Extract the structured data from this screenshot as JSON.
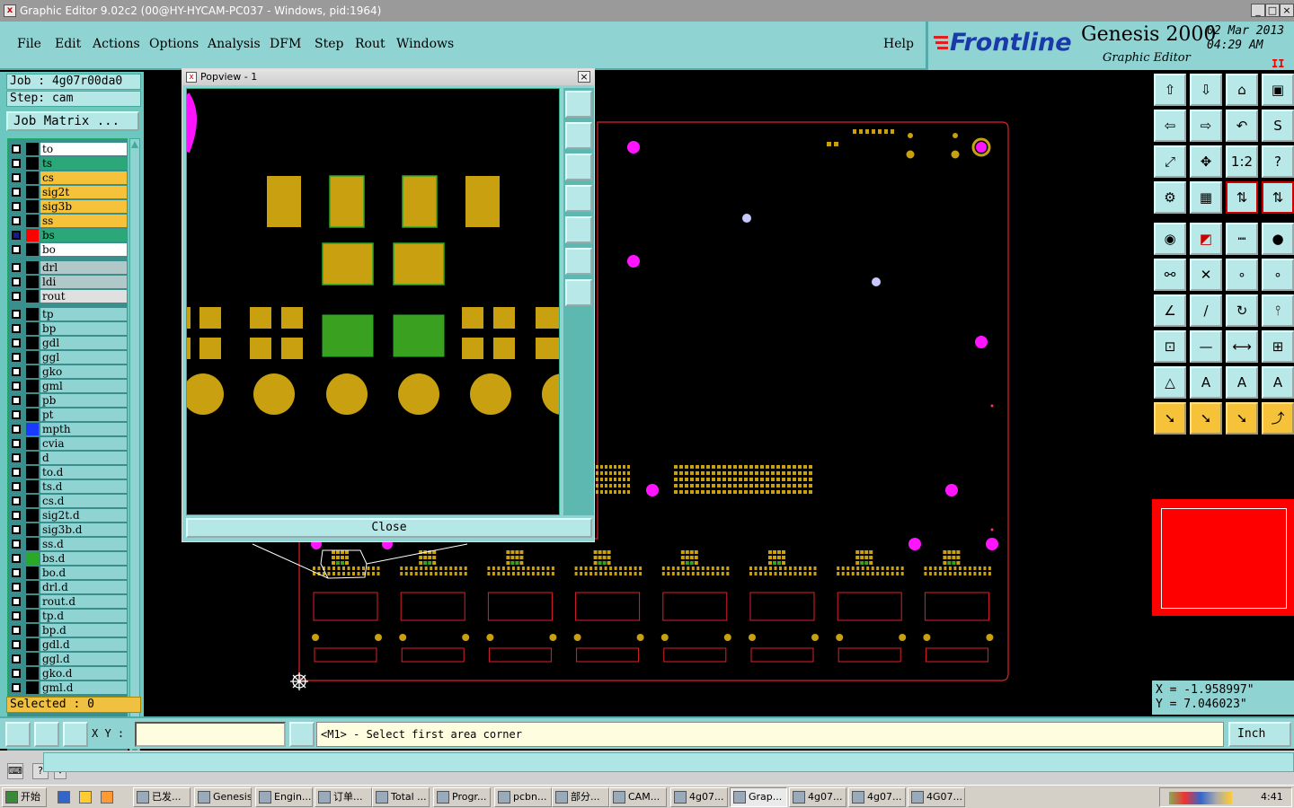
{
  "window": {
    "title": "Graphic Editor 9.02c2 (00@HY-HYCAM-PC037 - Windows, pid:1964)",
    "minimize": "_",
    "maximize": "□",
    "close": "×"
  },
  "menu": {
    "items": [
      "File",
      "Edit",
      "Actions",
      "Options",
      "Analysis",
      "DFM",
      "Step",
      "Rout",
      "Windows"
    ],
    "help": "Help"
  },
  "brand": {
    "logo": "Frontline",
    "product": "Genesis 2000",
    "subtitle": "Graphic Editor",
    "date": "02 Mar 2013",
    "time": "04:29 AM",
    "pause": "II",
    "logo_color": "#1a3aa8"
  },
  "left": {
    "job": "Job : 4g07r00da0",
    "step": "Step: cam",
    "job_matrix": "Job Matrix ...",
    "selected": "Selected : 0",
    "layers": [
      {
        "name": "to",
        "color": "#ffffff",
        "swatch": "#000000"
      },
      {
        "name": "ts",
        "color": "#2aa878",
        "swatch": "#000000"
      },
      {
        "name": "cs",
        "color": "#f6c23a",
        "swatch": "#000000"
      },
      {
        "name": "sig2t",
        "color": "#f6c23a",
        "swatch": "#000000"
      },
      {
        "name": "sig3b",
        "color": "#f6c23a",
        "swatch": "#000000"
      },
      {
        "name": "ss",
        "color": "#f6c23a",
        "swatch": "#000000"
      },
      {
        "name": "bs",
        "color": "#2aa878",
        "swatch": "#ff0000",
        "active": true
      },
      {
        "name": "bo",
        "color": "#ffffff",
        "swatch": "#000000"
      },
      {
        "name": "drl",
        "color": "#b0c8c8",
        "swatch": "#000000",
        "gap": true
      },
      {
        "name": "ldi",
        "color": "#b0c8c8",
        "swatch": "#000000"
      },
      {
        "name": "rout",
        "color": "#e0e0e0",
        "swatch": "#000000"
      },
      {
        "name": "tp",
        "color": "#8fd3d3",
        "swatch": "#000000",
        "gap": true
      },
      {
        "name": "bp",
        "color": "#8fd3d3",
        "swatch": "#000000"
      },
      {
        "name": "gdl",
        "color": "#8fd3d3",
        "swatch": "#000000"
      },
      {
        "name": "ggl",
        "color": "#8fd3d3",
        "swatch": "#000000"
      },
      {
        "name": "gko",
        "color": "#8fd3d3",
        "swatch": "#000000"
      },
      {
        "name": "gml",
        "color": "#8fd3d3",
        "swatch": "#000000"
      },
      {
        "name": "pb",
        "color": "#8fd3d3",
        "swatch": "#000000"
      },
      {
        "name": "pt",
        "color": "#8fd3d3",
        "swatch": "#000000"
      },
      {
        "name": "mpth",
        "color": "#8fd3d3",
        "swatch": "#1a3aff"
      },
      {
        "name": "cvia",
        "color": "#8fd3d3",
        "swatch": "#000000"
      },
      {
        "name": "d",
        "color": "#8fd3d3",
        "swatch": "#000000"
      },
      {
        "name": "to.d",
        "color": "#8fd3d3",
        "swatch": "#000000"
      },
      {
        "name": "ts.d",
        "color": "#8fd3d3",
        "swatch": "#000000"
      },
      {
        "name": "cs.d",
        "color": "#8fd3d3",
        "swatch": "#000000"
      },
      {
        "name": "sig2t.d",
        "color": "#8fd3d3",
        "swatch": "#000000"
      },
      {
        "name": "sig3b.d",
        "color": "#8fd3d3",
        "swatch": "#000000"
      },
      {
        "name": "ss.d",
        "color": "#8fd3d3",
        "swatch": "#000000"
      },
      {
        "name": "bs.d",
        "color": "#8fd3d3",
        "swatch": "#2aa828"
      },
      {
        "name": "bo.d",
        "color": "#8fd3d3",
        "swatch": "#000000"
      },
      {
        "name": "drl.d",
        "color": "#8fd3d3",
        "swatch": "#000000"
      },
      {
        "name": "rout.d",
        "color": "#8fd3d3",
        "swatch": "#000000"
      },
      {
        "name": "tp.d",
        "color": "#8fd3d3",
        "swatch": "#000000"
      },
      {
        "name": "bp.d",
        "color": "#8fd3d3",
        "swatch": "#000000"
      },
      {
        "name": "gdl.d",
        "color": "#8fd3d3",
        "swatch": "#000000"
      },
      {
        "name": "ggl.d",
        "color": "#8fd3d3",
        "swatch": "#000000"
      },
      {
        "name": "gko.d",
        "color": "#8fd3d3",
        "swatch": "#000000"
      },
      {
        "name": "gml.d",
        "color": "#8fd3d3",
        "swatch": "#000000"
      }
    ]
  },
  "popview": {
    "title": "Popview - 1",
    "close_label": "Close"
  },
  "coords": {
    "x": "X = -1.958997\"",
    "y": "Y = 7.046023\""
  },
  "command": {
    "xy_label": "X Y :",
    "xy_value": "",
    "prompt": "<M1> - Select first area corner",
    "units": "Inch"
  },
  "taskbar": {
    "start": "开始",
    "tasks": [
      "已发...",
      "Genesis",
      "Engin...",
      "订单...",
      "Total ...",
      "Progr...",
      "pcbn...",
      "部分...",
      "CAM...",
      "4g07...",
      "Grap...",
      "4g07...",
      "4g07...",
      "4G07..."
    ],
    "active_index": 10,
    "clock": "4:41"
  },
  "colors": {
    "pad_gold": "#c8a010",
    "pad_green": "#3aa020",
    "via_magenta": "#ff14ff",
    "profile_red": "#e0202a",
    "panel_cyan": "#8fd3d3"
  }
}
